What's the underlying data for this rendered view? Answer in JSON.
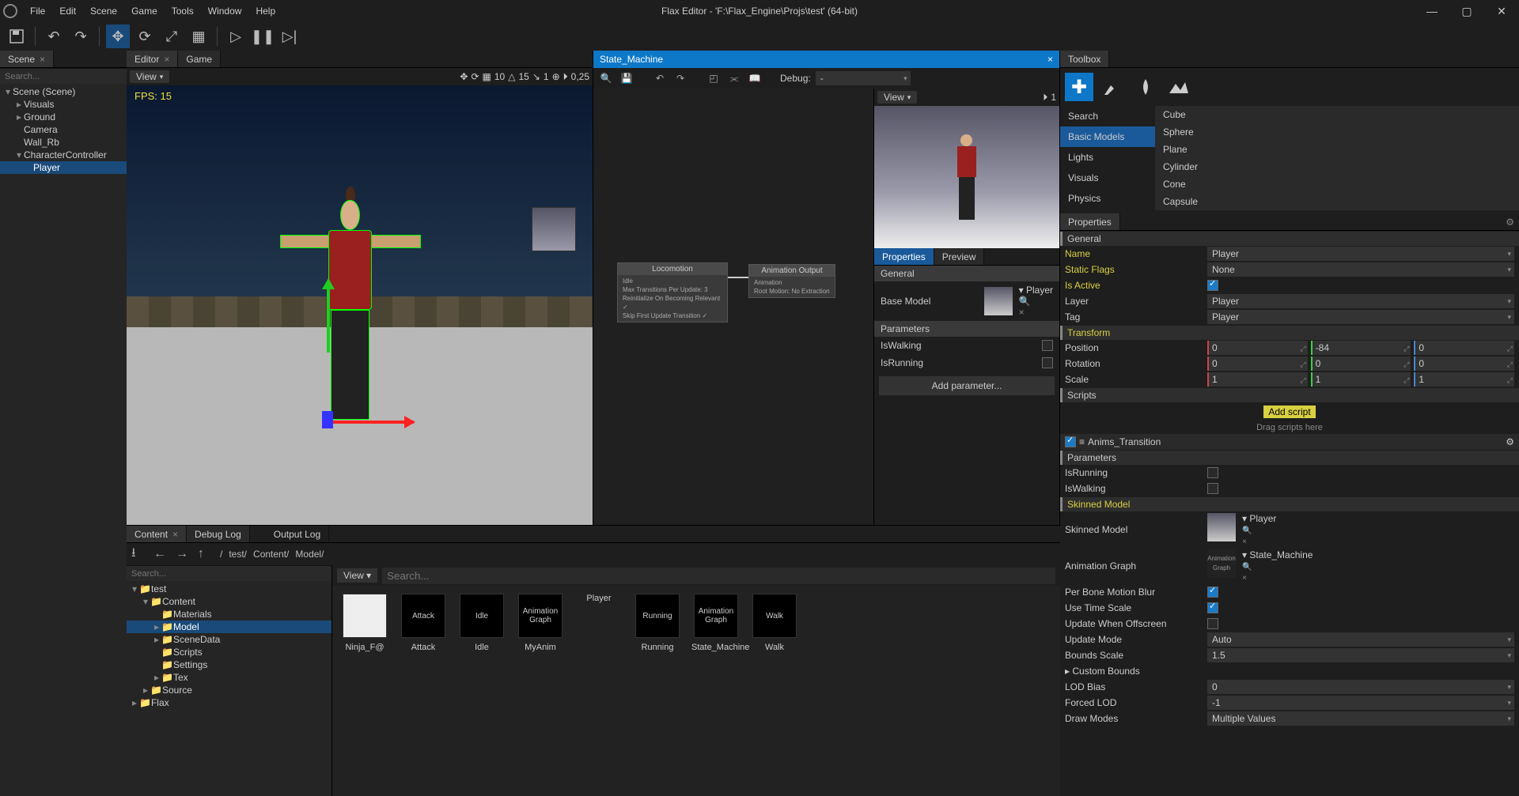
{
  "app": {
    "title": "Flax Editor - 'F:\\Flax_Engine\\Projs\\test' (64-bit)"
  },
  "menubar": [
    "File",
    "Edit",
    "Scene",
    "Game",
    "Tools",
    "Window",
    "Help"
  ],
  "scene_panel": {
    "tab": "Scene",
    "search_ph": "Search...",
    "nodes": [
      "Scene (Scene)",
      "Visuals",
      "Ground",
      "Camera",
      "Wall_Rb",
      "CharacterController",
      "Player"
    ]
  },
  "editor_tabs": {
    "a": "Editor",
    "b": "Game"
  },
  "viewport": {
    "view_label": "View",
    "fps": "FPS: 15",
    "grid": "10",
    "snap_angle": "15",
    "snap_scale": "1",
    "cam_speed": "0,25"
  },
  "state_machine": {
    "title": "State_Machine",
    "debug_label": "Debug:",
    "debug_value": "-",
    "node_a_title": "Locomotion",
    "node_a_l1": "Idle",
    "node_a_l2": "Max Transitions Per Update: 3",
    "node_a_l3": "Reinitialize On Becoming Relevant ✓",
    "node_a_l4": "Skip First Update Transition ✓",
    "node_b_title": "Animation Output",
    "node_b_l1": "Animation",
    "node_b_l2": "Root Motion:   No Extraction"
  },
  "sm_preview": {
    "view_label": "View",
    "count": "1",
    "tab_props": "Properties",
    "tab_preview": "Preview",
    "general": "General",
    "base_model": "Base Model",
    "player_label": "Player",
    "parameters": "Parameters",
    "p1": "IsWalking",
    "p2": "IsRunning",
    "add_param": "Add parameter..."
  },
  "toolbox": {
    "tab": "Toolbox",
    "cat_search": "Search",
    "cat_basic": "Basic Models",
    "cat_lights": "Lights",
    "cat_visuals": "Visuals",
    "cat_physics": "Physics",
    "items": [
      "Cube",
      "Sphere",
      "Plane",
      "Cylinder",
      "Cone",
      "Capsule"
    ]
  },
  "properties": {
    "tab": "Properties",
    "g_general": "General",
    "name_lbl": "Name",
    "name_val": "Player",
    "static_lbl": "Static Flags",
    "static_val": "None",
    "active_lbl": "Is Active",
    "layer_lbl": "Layer",
    "layer_val": "Player",
    "tag_lbl": "Tag",
    "tag_val": "Player",
    "g_transform": "Transform",
    "pos_lbl": "Position",
    "pos": [
      "0",
      "-84",
      "0"
    ],
    "rot_lbl": "Rotation",
    "rot": [
      "0",
      "0",
      "0"
    ],
    "scale_lbl": "Scale",
    "scale": [
      "1",
      "1",
      "1"
    ],
    "g_scripts": "Scripts",
    "add_script": "Add script",
    "drag_hint": "Drag scripts here",
    "script_name": "Anims_Transition",
    "g_params": "Parameters",
    "param1": "IsRunning",
    "param2": "IsWalking",
    "g_skinned": "Skinned Model",
    "skinned_lbl": "Skinned Model",
    "skinned_val": "Player",
    "anim_graph_lbl": "Animation Graph",
    "anim_graph_val": "State_Machine",
    "anim_graph_thumb": "Animation Graph",
    "blur_lbl": "Per Bone Motion Blur",
    "timescale_lbl": "Use Time Scale",
    "offscreen_lbl": "Update When Offscreen",
    "upmode_lbl": "Update Mode",
    "upmode_val": "Auto",
    "bounds_lbl": "Bounds Scale",
    "bounds_val": "1.5",
    "custom_bounds": "Custom Bounds",
    "lod_bias_lbl": "LOD Bias",
    "lod_bias_val": "0",
    "forced_lod_lbl": "Forced LOD",
    "forced_lod_val": "-1",
    "draw_modes_lbl": "Draw Modes",
    "draw_modes_val": "Multiple Values"
  },
  "bottom_tabs": {
    "a": "Content",
    "b": "Debug Log",
    "c": "Output Log"
  },
  "content": {
    "path": [
      "/",
      "test/",
      "Content/",
      "Model/"
    ],
    "view_label": "View",
    "search_ph": "Search...",
    "tree": {
      "root": "test",
      "content": "Content",
      "materials": "Materials",
      "model": "Model",
      "scenedata": "SceneData",
      "scripts": "Scripts",
      "settings": "Settings",
      "tex": "Tex",
      "source": "Source",
      "flax": "Flax"
    },
    "items": [
      {
        "t": "folder",
        "thumb": "",
        "label": "Ninja_F@"
      },
      {
        "t": "anim",
        "thumb": "Attack",
        "label": "Attack"
      },
      {
        "t": "anim",
        "thumb": "Idle",
        "label": "Idle"
      },
      {
        "t": "anim",
        "thumb": "Animation Graph",
        "label": "MyAnim"
      },
      {
        "t": "char",
        "thumb": "",
        "label": "Player"
      },
      {
        "t": "anim",
        "thumb": "Running",
        "label": "Running"
      },
      {
        "t": "anim",
        "thumb": "Animation Graph",
        "label": "State_Machine"
      },
      {
        "t": "anim",
        "thumb": "Walk",
        "label": "Walk"
      }
    ]
  }
}
